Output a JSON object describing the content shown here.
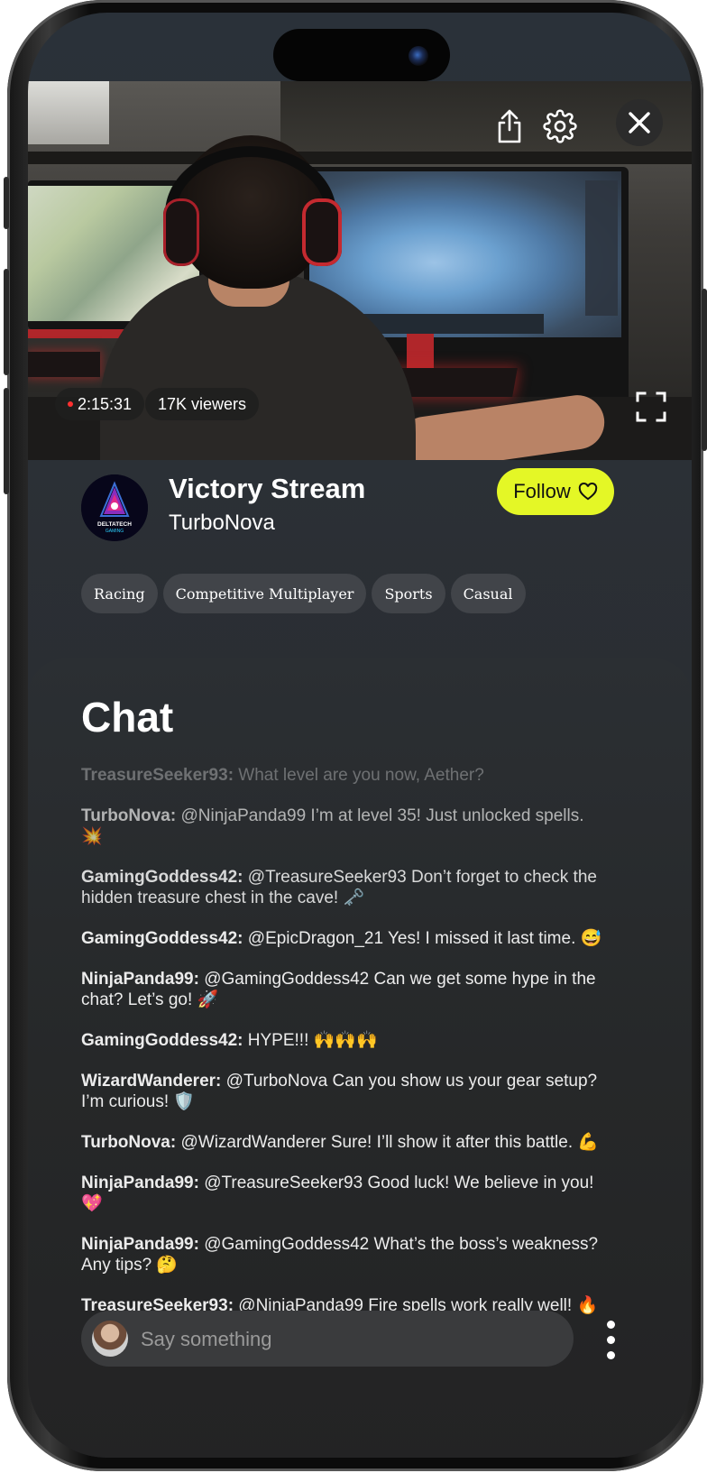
{
  "video": {
    "duration": "2:15:31",
    "viewers": "17K viewers",
    "icons": [
      "share-icon",
      "gear-icon",
      "close-icon",
      "fullscreen-icon"
    ]
  },
  "stream": {
    "title": "Victory Stream",
    "streamer": "TurboNova",
    "follow_label": "Follow",
    "logo_text": "DELTATECH GAMING",
    "tags": [
      "Racing",
      "Competitive Multiplayer",
      "Sports",
      "Casual"
    ]
  },
  "chat": {
    "title": "Chat",
    "messages": [
      {
        "user": "TreasureSeeker93:",
        "text": "What level are you now, Aether?"
      },
      {
        "user": "TurboNova:",
        "text": "@NinjaPanda99 I’m at level 35! Just unlocked spells. 💥"
      },
      {
        "user": "GamingGoddess42:",
        "text": "@TreasureSeeker93 Don’t forget to check the hidden treasure chest in the cave! 🗝️"
      },
      {
        "user": "GamingGoddess42:",
        "text": "@EpicDragon_21 Yes! I missed it last time. 😅"
      },
      {
        "user": "NinjaPanda99:",
        "text": "@GamingGoddess42 Can we get some hype in the chat? Let’s go! 🚀"
      },
      {
        "user": "GamingGoddess42:",
        "text": "HYPE!!! 🙌🙌🙌"
      },
      {
        "user": "WizardWanderer:",
        "text": "@TurboNova Can you show us your gear setup? I’m curious! 🛡️"
      },
      {
        "user": "TurboNova:",
        "text": "@WizardWanderer Sure! I’ll show it after this battle. 💪"
      },
      {
        "user": "NinjaPanda99:",
        "text": "@TreasureSeeker93 Good luck! We believe in you! 💖"
      },
      {
        "user": "NinjaPanda99:",
        "text": "@GamingGoddess42 What’s the boss’s weakness? Any tips? 🤔"
      },
      {
        "user": "TreasureSeeker93:",
        "text": "@NinjaPanda99 Fire spells work really well! 🔥"
      }
    ],
    "input_placeholder": "Say something"
  },
  "colors": {
    "accent": "#e4f726",
    "background": "#2a2c30",
    "live_dot": "#ff3030"
  }
}
